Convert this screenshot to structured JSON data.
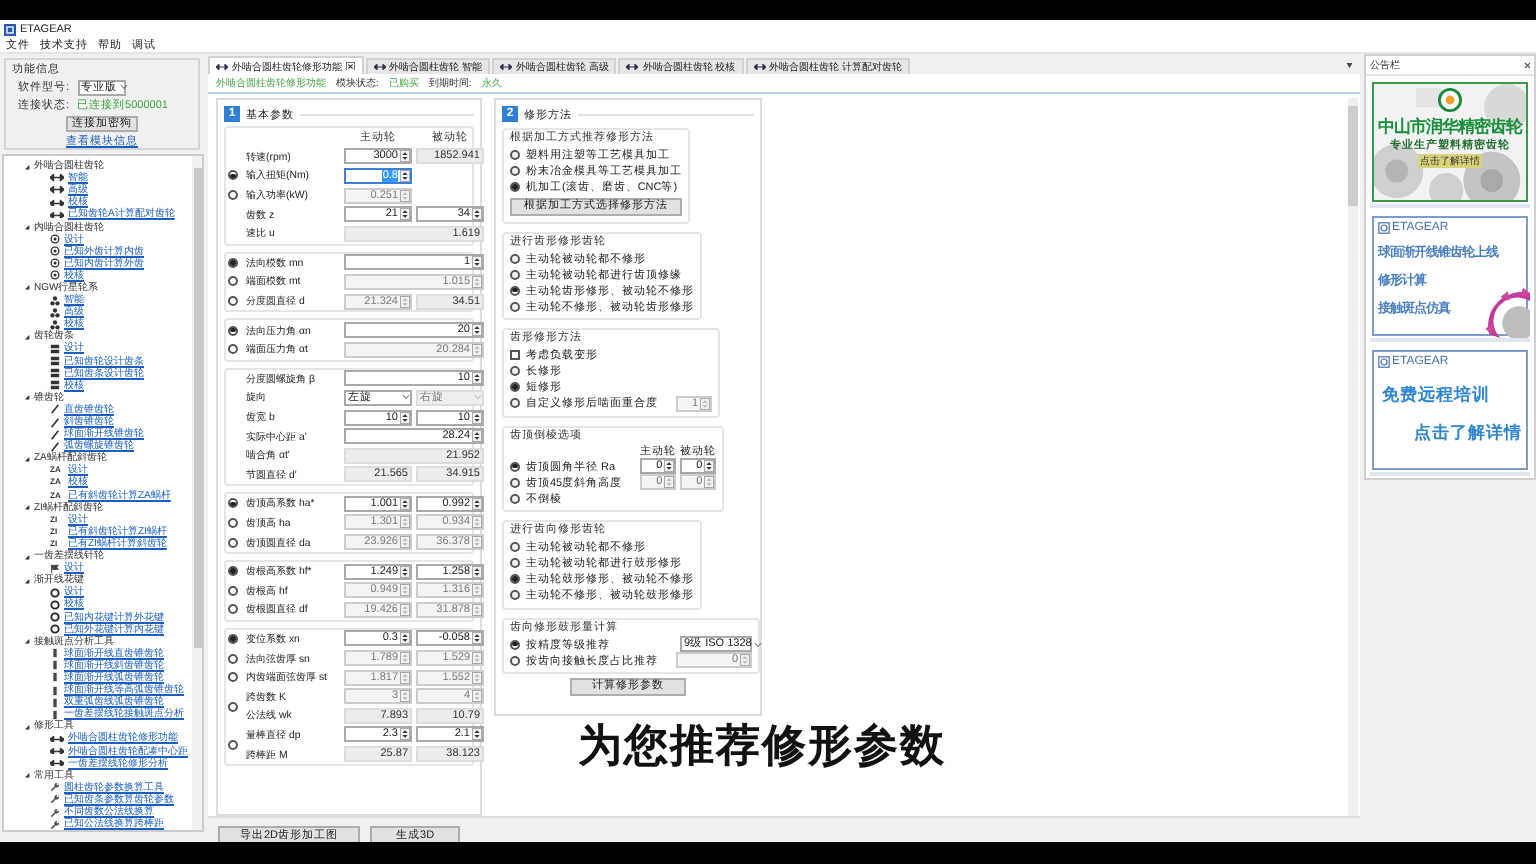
{
  "window": {
    "title": "ETAGEAR"
  },
  "menu": [
    "文件",
    "技术支持",
    "帮助",
    "调试"
  ],
  "sidebar": {
    "info": {
      "title": "功能信息",
      "model_label": "软件型号:",
      "model_value": "专业版",
      "status_label": "连接状态:",
      "status_value": "已连接到5000001",
      "connect_button": "连接加密狗",
      "module_link": "查看模块信息"
    },
    "tree": [
      {
        "label": "外啮合圆柱齿轮",
        "expanded": true,
        "children": [
          {
            "label": "智能"
          },
          {
            "label": "高级"
          },
          {
            "label": "校核"
          },
          {
            "label": "已知齿轮A计算配对齿轮"
          }
        ]
      },
      {
        "label": "内啮合圆柱齿轮",
        "expanded": true,
        "children": [
          {
            "label": "设计"
          },
          {
            "label": "已知外齿计算内齿"
          },
          {
            "label": "已知内齿计算外齿"
          },
          {
            "label": "校核"
          }
        ]
      },
      {
        "label": "NGW行星轮系",
        "expanded": true,
        "children": [
          {
            "label": "智能"
          },
          {
            "label": "高级"
          },
          {
            "label": "校核"
          }
        ]
      },
      {
        "label": "齿轮齿条",
        "expanded": true,
        "children": [
          {
            "label": "设计"
          },
          {
            "label": "已知齿轮设计齿条"
          },
          {
            "label": "已知齿条设计齿轮"
          },
          {
            "label": "校核"
          }
        ]
      },
      {
        "label": "锥齿轮",
        "expanded": true,
        "children": [
          {
            "label": "直齿锥齿轮"
          },
          {
            "label": "斜齿锥齿轮"
          },
          {
            "label": "球面渐开线锥齿轮"
          },
          {
            "label": "弧齿螺旋锥齿轮"
          }
        ]
      },
      {
        "label": "ZA蜗杆配斜齿轮",
        "expanded": true,
        "children": [
          {
            "badge": "ZA",
            "label": "设计"
          },
          {
            "badge": "ZA",
            "label": "校核"
          },
          {
            "badge": "ZA",
            "label": "已有斜齿轮计算ZA蜗杆"
          }
        ]
      },
      {
        "label": "ZI蜗杆配斜齿轮",
        "expanded": true,
        "children": [
          {
            "badge": "ZI",
            "label": "设计"
          },
          {
            "badge": "ZI",
            "label": "已有斜齿轮计算ZI蜗杆"
          },
          {
            "badge": "ZI",
            "label": "已有ZI蜗杆计算斜齿轮"
          }
        ]
      },
      {
        "label": "一齿差摆线针轮",
        "expanded": true,
        "children": [
          {
            "label": "设计"
          }
        ]
      },
      {
        "label": "渐开线花键",
        "expanded": true,
        "children": [
          {
            "label": "设计"
          },
          {
            "label": "校核"
          },
          {
            "label": "已知内花键计算外花键"
          },
          {
            "label": "已知外花键计算内花键"
          }
        ]
      },
      {
        "label": "接触斑点分析工具",
        "expanded": true,
        "children": [
          {
            "label": "球面渐开线直齿锥齿轮"
          },
          {
            "label": "球面渐开线斜齿锥齿轮"
          },
          {
            "label": "球面渐开线弧齿锥齿轮"
          },
          {
            "label": "球面渐开线等高弧齿锥齿轮"
          },
          {
            "label": "双重弧齿线弧齿锥齿轮"
          },
          {
            "label": "一齿差摆线轮接触斑点分析"
          }
        ]
      },
      {
        "label": "修形工具",
        "expanded": true,
        "children": [
          {
            "label": "外啮合圆柱齿轮修形功能"
          },
          {
            "label": "外啮合圆柱齿轮配凑中心距"
          },
          {
            "label": "一齿差摆线轮修形分析"
          }
        ]
      },
      {
        "label": "常用工具",
        "expanded": true,
        "children": [
          {
            "label": "圆柱齿轮参数换算工具"
          },
          {
            "label": "已知齿条参数算齿轮参数"
          },
          {
            "label": "不同齿数公法线换算"
          },
          {
            "label": "已知公法线换算跨棒距"
          }
        ]
      }
    ]
  },
  "tabs": [
    {
      "label": "外啮合圆柱齿轮修形功能",
      "selected": true
    },
    {
      "label": "外啮合圆柱齿轮 智能",
      "selected": false
    },
    {
      "label": "外啮合圆柱齿轮 高级",
      "selected": false
    },
    {
      "label": "外啮合圆柱齿轮 校核",
      "selected": false
    },
    {
      "label": "外啮合圆柱齿轮 计算配对齿轮",
      "selected": false
    }
  ],
  "module_status": {
    "module": "外啮合圆柱齿轮修形功能",
    "status_label": "模块状态:",
    "status": "已购买",
    "expiry_label": "到期时间:",
    "expiry": "永久"
  },
  "basic": {
    "number": "1",
    "title": "基本参数",
    "headers": [
      "主动轮",
      "被动轮"
    ],
    "groups": [
      {
        "rows": [
          {
            "label": "转速(rpm)",
            "fields": [
              {
                "value": "3000",
                "kind": "spin"
              },
              {
                "value": "1852.941",
                "kind": "readonly"
              }
            ]
          },
          {
            "label": "输入扭矩(Nm)",
            "selected": true,
            "fields": [
              {
                "value": "0.8",
                "kind": "active"
              }
            ]
          },
          {
            "label": "输入功率(kW)",
            "selected": false,
            "fields": [
              {
                "value": "0.251",
                "kind": "disabled"
              }
            ]
          },
          {
            "label": "齿数 z",
            "fields": [
              {
                "value": "21",
                "kind": "spin"
              },
              {
                "value": "34",
                "kind": "spin"
              }
            ]
          },
          {
            "label": "速比 u",
            "fields": [
              {
                "value": "1.619",
                "kind": "readonly",
                "wide": true
              }
            ]
          }
        ]
      },
      {
        "rows": [
          {
            "label": "法向模数 mn",
            "selected": true,
            "fields": [
              {
                "value": "1",
                "kind": "spin",
                "wide": true
              }
            ]
          },
          {
            "label": "端面模数 mt",
            "selected": false,
            "fields": [
              {
                "value": "1.015",
                "kind": "disabled",
                "wide": true
              }
            ]
          },
          {
            "label": "分度圆直径 d",
            "selected": false,
            "fields": [
              {
                "value": "21.324",
                "kind": "disabled"
              },
              {
                "value": "34.51",
                "kind": "readonly"
              }
            ]
          }
        ]
      },
      {
        "rows": [
          {
            "label": "法向压力角 αn",
            "selected": true,
            "fields": [
              {
                "value": "20",
                "kind": "spin",
                "wide": true
              }
            ]
          },
          {
            "label": "端面压力角 αt",
            "selected": false,
            "fields": [
              {
                "value": "20.284",
                "kind": "disabled",
                "wide": true
              }
            ]
          }
        ]
      },
      {
        "rows": [
          {
            "label": "分度圆螺旋角 β",
            "fields": [
              {
                "value": "10",
                "kind": "spin",
                "wide": true
              }
            ]
          },
          {
            "label": "旋向",
            "fields": [
              {
                "value": "左旋",
                "kind": "dropdown"
              },
              {
                "value": "右旋",
                "kind": "dropdown-disabled"
              }
            ]
          },
          {
            "label": "齿宽 b",
            "fields": [
              {
                "value": "10",
                "kind": "spin"
              },
              {
                "value": "10",
                "kind": "spin"
              }
            ]
          },
          {
            "label": "实际中心距 a'",
            "fields": [
              {
                "value": "28.24",
                "kind": "spin",
                "wide": true
              }
            ]
          },
          {
            "label": "啮合角 αt'",
            "fields": [
              {
                "value": "21.952",
                "kind": "readonly",
                "wide": true
              }
            ]
          },
          {
            "label": "节圆直径 d'",
            "fields": [
              {
                "value": "21.565",
                "kind": "readonly"
              },
              {
                "value": "34.915",
                "kind": "readonly"
              }
            ]
          }
        ]
      },
      {
        "rows": [
          {
            "label": "齿顶高系数 ha*",
            "selected": true,
            "fields": [
              {
                "value": "1.001",
                "kind": "spin"
              },
              {
                "value": "0.992",
                "kind": "spin"
              }
            ]
          },
          {
            "label": "齿顶高 ha",
            "selected": false,
            "fields": [
              {
                "value": "1.301",
                "kind": "disabled"
              },
              {
                "value": "0.934",
                "kind": "disabled"
              }
            ]
          },
          {
            "label": "齿顶圆直径 da",
            "selected": false,
            "fields": [
              {
                "value": "23.926",
                "kind": "disabled"
              },
              {
                "value": "36.378",
                "kind": "disabled"
              }
            ]
          }
        ]
      },
      {
        "rows": [
          {
            "label": "齿根高系数 hf*",
            "selected": true,
            "fields": [
              {
                "value": "1.249",
                "kind": "spin"
              },
              {
                "value": "1.258",
                "kind": "spin"
              }
            ]
          },
          {
            "label": "齿根高 hf",
            "selected": false,
            "fields": [
              {
                "value": "0.949",
                "kind": "disabled"
              },
              {
                "value": "1.316",
                "kind": "disabled"
              }
            ]
          },
          {
            "label": "齿根圆直径 df",
            "selected": false,
            "fields": [
              {
                "value": "19.426",
                "kind": "disabled"
              },
              {
                "value": "31.878",
                "kind": "disabled"
              }
            ]
          }
        ]
      },
      {
        "rows": [
          {
            "label": "变位系数 xn",
            "selected": true,
            "fields": [
              {
                "value": "0.3",
                "kind": "spin"
              },
              {
                "value": "-0.058",
                "kind": "spin"
              }
            ]
          },
          {
            "label": "法向弦齿厚 sn",
            "selected": false,
            "fields": [
              {
                "value": "1.789",
                "kind": "disabled"
              },
              {
                "value": "1.529",
                "kind": "disabled"
              }
            ]
          },
          {
            "label": "内齿端面弦齿厚 st",
            "selected": false,
            "fields": [
              {
                "value": "1.817",
                "kind": "disabled"
              },
              {
                "value": "1.552",
                "kind": "disabled"
              }
            ]
          },
          {
            "kind": "double",
            "selected": false,
            "lines": [
              {
                "label": "跨齿数 K",
                "fields": [
                  {
                    "value": "3",
                    "kind": "disabled"
                  },
                  {
                    "value": "4",
                    "kind": "disabled"
                  }
                ]
              },
              {
                "label": "公法线 wk",
                "fields": [
                  {
                    "value": "7.893",
                    "kind": "readonly"
                  },
                  {
                    "value": "10.79",
                    "kind": "readonly"
                  }
                ]
              }
            ]
          },
          {
            "kind": "double",
            "selected": false,
            "lines": [
              {
                "label": "量棒直径 dp",
                "fields": [
                  {
                    "value": "2.3",
                    "kind": "spin"
                  },
                  {
                    "value": "2.1",
                    "kind": "spin"
                  }
                ]
              },
              {
                "label": "跨棒距 M",
                "fields": [
                  {
                    "value": "25.87",
                    "kind": "readonly"
                  },
                  {
                    "value": "38.123",
                    "kind": "readonly"
                  }
                ]
              }
            ]
          }
        ]
      }
    ]
  },
  "modification": {
    "number": "2",
    "title": "修形方法",
    "groups": [
      {
        "title": "根据加工方式推荐修形方法",
        "items": [
          {
            "kind": "radio",
            "label": "塑料用注塑等工艺模具加工",
            "selected": false
          },
          {
            "kind": "radio",
            "label": "粉末冶金模具等工艺模具加工",
            "selected": false
          },
          {
            "kind": "radio",
            "label": "机加工(滚齿、磨齿、CNC等)",
            "selected": true
          },
          {
            "kind": "button",
            "label": "根据加工方式选择修形方法"
          }
        ]
      },
      {
        "title": "进行齿形修形齿轮",
        "items": [
          {
            "kind": "radio",
            "label": "主动轮被动轮都不修形",
            "selected": false
          },
          {
            "kind": "radio",
            "label": "主动轮被动轮都进行齿顶修缘",
            "selected": false
          },
          {
            "kind": "radio",
            "label": "主动轮齿形修形、被动轮不修形",
            "selected": true
          },
          {
            "kind": "radio",
            "label": "主动轮不修形、被动轮齿形修形",
            "selected": false
          }
        ]
      },
      {
        "title": "齿形修形方法",
        "items": [
          {
            "kind": "checkbox",
            "label": "考虑负载变形",
            "checked": false
          },
          {
            "kind": "radio",
            "label": "长修形",
            "selected": false
          },
          {
            "kind": "radio",
            "label": "短修形",
            "selected": true
          },
          {
            "kind": "radio",
            "label": "自定义修形后啮面重合度",
            "selected": false,
            "fields": [
              {
                "value": "1",
                "kind": "disabled"
              }
            ]
          }
        ]
      },
      {
        "title": "齿顶倒棱选项",
        "headers": [
          "主动轮",
          "被动轮"
        ],
        "items": [
          {
            "kind": "radio",
            "label": "齿顶圆角半径 Ra",
            "selected": true,
            "fields": [
              {
                "value": "0",
                "kind": "spin"
              },
              {
                "value": "0",
                "kind": "spin"
              }
            ]
          },
          {
            "kind": "radio",
            "label": "齿顶45度斜角高度",
            "selected": false,
            "fields": [
              {
                "value": "0",
                "kind": "disabled"
              },
              {
                "value": "0",
                "kind": "disabled"
              }
            ]
          },
          {
            "kind": "radio",
            "label": "不倒棱",
            "selected": false
          }
        ]
      },
      {
        "title": "进行齿向修形齿轮",
        "items": [
          {
            "kind": "radio",
            "label": "主动轮被动轮都不修形",
            "selected": false
          },
          {
            "kind": "radio",
            "label": "主动轮被动轮都进行鼓形修形",
            "selected": false
          },
          {
            "kind": "radio",
            "label": "主动轮鼓形修形、被动轮不修形",
            "selected": true
          },
          {
            "kind": "radio",
            "label": "主动轮不修形、被动轮鼓形修形",
            "selected": false
          }
        ]
      },
      {
        "title": "齿向修形鼓形量计算",
        "items": [
          {
            "kind": "radio",
            "label": "按精度等级推荐",
            "selected": true,
            "fields": [
              {
                "value": "9级 ISO 1328",
                "kind": "dropdown"
              }
            ]
          },
          {
            "kind": "radio",
            "label": "按齿向接触长度占比推荐",
            "selected": false,
            "fields": [
              {
                "value": "0",
                "kind": "disabled",
                "wide": true
              }
            ]
          }
        ]
      }
    ],
    "button": "计算修形参数"
  },
  "bottom_buttons": [
    "导出2D齿形加工图",
    "生成3D"
  ],
  "notice": {
    "title": "公告栏",
    "ads": [
      {
        "kind": "company",
        "lines": [
          "中山市润华精密齿轮",
          "专业生产塑料精密齿轮",
          "点击了解详情"
        ]
      },
      {
        "kind": "feature",
        "brand": "ETAGEAR",
        "lines": [
          "球面渐开线锥齿轮上线",
          "修形计算",
          "接触斑点仿真"
        ]
      },
      {
        "kind": "training",
        "brand": "ETAGEAR",
        "lines": [
          "免费远程培训",
          "点击了解详情"
        ]
      }
    ]
  },
  "caption": "为您推荐修形参数"
}
